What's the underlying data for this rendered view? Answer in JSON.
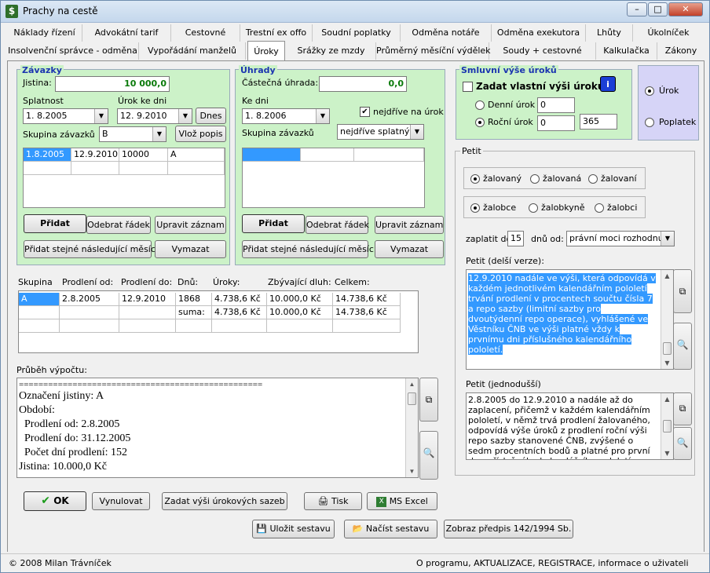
{
  "window": {
    "title": "Prachy na cestě",
    "icon": "dollar-app-icon",
    "controls": {
      "minimize": "–",
      "maximize": "□",
      "close": "✕"
    }
  },
  "tabs_row1": [
    "Náklady řízení",
    "Advokátní tarif",
    "Cestovné",
    "Trestní ex offo",
    "Soudní poplatky",
    "Odměna notáře",
    "Odměna exekutora",
    "Lhůty",
    "Úkolníček"
  ],
  "tabs_row2": [
    "Insolvenční správce - odměna",
    "Vypořádání manželů",
    "Úroky",
    "Srážky ze mzdy",
    "Průměrný měsíční výdělek",
    "Soudy + cestovné",
    "Kalkulačka",
    "Zákony"
  ],
  "active_tab": "Úroky",
  "zavazky": {
    "title": "Závazky",
    "jistina_label": "Jistina:",
    "jistina_value": "10 000,0",
    "splatnost_label": "Splatnost",
    "splatnost_value": " 1. 8.2005",
    "urok_ke_dni_label": "Úrok ke dni",
    "urok_ke_dni_value": "12. 9.2010",
    "dnes_button": "Dnes",
    "skupina_label": "Skupina závazků",
    "skupina_value": "B",
    "vloz_popis_button": "Vlož popis",
    "rows": [
      [
        "1.8.2005",
        "12.9.2010",
        "10000",
        "A"
      ]
    ],
    "pridat_button": "Přidat",
    "odebrat_button": "Odebrat řádek",
    "upravit_button": "Upravit záznam",
    "pridat_stejne_button": "Přidat stejné následující měsíc",
    "vymazat_button": "Vymazat"
  },
  "uhrady": {
    "title": "Úhrady",
    "castecna_label": "Částečná úhrada:",
    "castecna_value": "0,0",
    "ke_dni_label": "Ke dni",
    "ke_dni_value": " 1. 8.2006",
    "nejdrive_label": "nejdříve na úrok",
    "nejdrive_checked": "✔",
    "skupina_label": "Skupina závazků",
    "order_value": "nejdříve splatný",
    "pridat_button": "Přidat",
    "odebrat_button": "Odebrat řádek",
    "upravit_button": "Upravit záznam",
    "pridat_stejne_button": "Přidat stejné následující měsíc",
    "vymazat_button": "Vymazat"
  },
  "smluvni": {
    "title": "Smluvní výše úroků",
    "zadat_label": "Zadat vlastní výši úroku:",
    "info_icon": "i",
    "denni_label": "Denní úrok",
    "denni_value": "0",
    "rocni_label": "Roční úrok",
    "rocni_value": "0",
    "days_value": "365"
  },
  "mode": {
    "urok_label": "Úrok",
    "poplatek_label": "Poplatek"
  },
  "result_table": {
    "headers": [
      "Skupina",
      "Prodlení od:",
      "Prodlení do:",
      "Dnů:",
      "Úroky:",
      "Zbývající dluh:",
      "Celkem:"
    ],
    "row1": [
      "A",
      "2.8.2005",
      "12.9.2010",
      "1868",
      "4.738,6 Kč",
      "10.000,0 Kč",
      "14.738,6 Kč"
    ],
    "row2": [
      "",
      "",
      "",
      "suma:",
      "4.738,6 Kč",
      "10.000,0 Kč",
      "14.738,6 Kč"
    ]
  },
  "prubeh": {
    "label": "Průběh výpočtu:",
    "lines": [
      "==================================================",
      "Označení jistiny: A",
      "Období:",
      "  Prodlení od: 2.8.2005",
      "  Prodlení do: 31.12.2005",
      "  Počet dní prodlení: 152",
      "Jistina: 10.000,0 Kč"
    ]
  },
  "petit": {
    "title": "Petit",
    "radio1": [
      "žalovaný",
      "žalovaná",
      "žalovaní"
    ],
    "radio2": [
      "žalobce",
      "žalobkyně",
      "žalobci"
    ],
    "zaplatit_label": "zaplatit do",
    "zaplatit_value": "15",
    "dnu_od_label": "dnů od:",
    "dnu_od_value": "právní moci rozhodnutí",
    "delsi_label": "Petit (delší verze):",
    "delsi_text": "12.9.2010 nadále ve výši, která odpovídá v každém jednotlivém kalendářním pololetí trvání prodlení v procentech součtu čísla 7 a repo sazby (limitní sazby pro dvoutýdenní repo operace), vyhlášené ve Věstníku ČNB ve výši platné vždy k prvnímu dni příslušného kalendářního pololetí.",
    "jednodussi_label": "Petit (jednodušší)",
    "jednodussi_text": "2.8.2005 do 12.9.2010 a nadále až do zaplacení, přičemž v každém kalendářním pololetí, v němž trvá prodlení žalovaného, odpovídá výše úroků z prodlení roční výši repo sazby stanovené ČNB, zvýšené o sedm procentních bodů a platné pro první den příslušného kalendářního pololetí."
  },
  "bottom": {
    "ok_button": "OK",
    "vynulovat_button": "Vynulovat",
    "zadat_sazeb_button": "Zadat výši úrokových sazeb",
    "tisk_button": "Tisk",
    "excel_button": "MS Excel",
    "ulozit_button": "Uložit sestavu",
    "nacist_button": "Načíst sestavu",
    "zobraz_button": "Zobraz předpis 142/1994 Sb."
  },
  "status": {
    "copyright": "© 2008 Milan Trávníček",
    "links": "O programu, AKTUALIZACE, REGISTRACE, informace o uživateli"
  },
  "colors": {
    "green_panel": "#ccf2c8",
    "violet_panel": "#d6d4f7",
    "legend_blue": "#1b35b0",
    "selection": "#3399ff",
    "jistina_green": "#0a7a0a"
  }
}
